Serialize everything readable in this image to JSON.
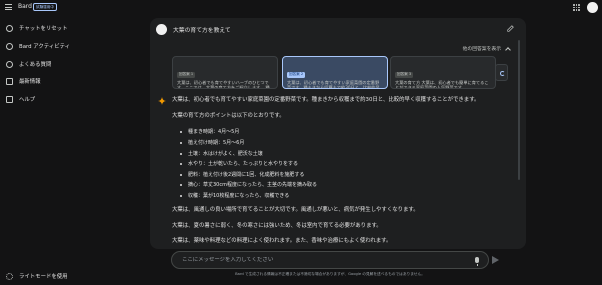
{
  "app": {
    "brand": "Bard",
    "badge": "試験運用中"
  },
  "sidebar": {
    "items": [
      {
        "label": "チャットをリセット",
        "icon": "reset-icon"
      },
      {
        "label": "Bard アクティビティ",
        "icon": "history-icon"
      },
      {
        "label": "よくある質問",
        "icon": "help-circle-icon"
      },
      {
        "label": "最新情報",
        "icon": "updates-icon"
      },
      {
        "label": "ヘルプ",
        "icon": "feedback-icon"
      }
    ],
    "bottom": {
      "label": "ライトモードを使用",
      "icon": "sun-icon"
    }
  },
  "prompt": {
    "text": "大葉の育て方を教えて"
  },
  "drafts": {
    "toggle_label": "他の回答案を表示",
    "items": [
      {
        "tag": "回答案 1",
        "text": "大葉は、初心者でも育てやすいハーブのひとつです。ここでは、大葉の育て方をご紹介します。 種まき..."
      },
      {
        "tag": "回答案 2",
        "text": "大葉は、初心者でも育てやすい家庭菜園の定番野菜です。種まきから収穫まで約30日と、比較的早く収穫できることが..."
      },
      {
        "tag": "回答案 3",
        "text": "大葉の育て方 大葉は、初心者でも簡単に育てることができる家庭菜園の人気野菜です..."
      }
    ]
  },
  "response": {
    "intro": "大葉は、初心者でも育てやすい家庭菜園の定番野菜です。種まきから収穫まで約30日と、比較的早く収穫することができます。",
    "points_heading": "大葉の育て方のポイントは以下のとおりです。",
    "bullets": [
      "種まき時期：4月〜5月",
      "植え付け時期：5月〜6月",
      "土壌：水はけがよく、肥沃な土壌",
      "水やり：土が乾いたら、たっぷりと水やりをする",
      "肥料：植え付け後2週間に1回、化成肥料を施肥する",
      "摘心：草丈30cm程度になったら、主茎の先端を摘み取る",
      "収穫：葉が10枚程度になったら、収穫できる"
    ],
    "p1": "大葉は、風通しの良い場所で育てることが大切です。風通しが悪いと、病気が発生しやすくなります。",
    "p2": "大葉は、夏の暑さに弱く、冬の寒さには強いため、冬は室内で育てる必要があります。",
    "p3": "大葉は、薬味や料理などの料理によく使われます。また、香味や治療にもよく使われます。"
  },
  "input": {
    "placeholder": "ここにメッセージを入力してください"
  },
  "disclaimer": "Bard で生成される情報は不正確または不適切な場合がありますが、Google の見解を述べるものではありません。"
}
